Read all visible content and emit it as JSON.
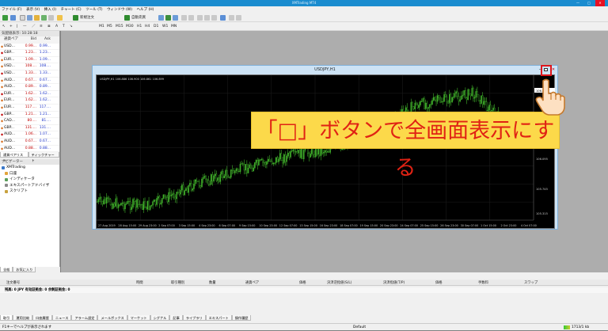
{
  "window": {
    "title": "XMTrading MT4",
    "controls": [
      "—",
      "□",
      "✕"
    ]
  },
  "menu": [
    "ファイル (F)",
    "表示 (V)",
    "挿入 (I)",
    "チャート (C)",
    "ツール (T)",
    "ウィンドウ (W)",
    "ヘルプ (H)"
  ],
  "toolbar1": {
    "new_order": "新規注文",
    "auto_trade": "自動売買"
  },
  "toolbar2": {
    "timeframes": [
      "M1",
      "M5",
      "M15",
      "M30",
      "H1",
      "H4",
      "D1",
      "W1",
      "MN"
    ]
  },
  "market_watch": {
    "title": "気配値表示: 10:28:18",
    "headers": [
      "通貨ペア",
      "Bid",
      "Ask"
    ],
    "rows": [
      {
        "symbol": "USD...",
        "bid": "0.99...",
        "ask": "0.99..."
      },
      {
        "symbol": "GBP...",
        "bid": "1.23...",
        "ask": "1.23..."
      },
      {
        "symbol": "EUR...",
        "bid": "1.09...",
        "ask": "1.09..."
      },
      {
        "symbol": "USD...",
        "bid": "108....",
        "ask": "108...."
      },
      {
        "symbol": "USD...",
        "bid": "1.33...",
        "ask": "1.33..."
      },
      {
        "symbol": "AUD...",
        "bid": "0.67...",
        "ask": "0.67..."
      },
      {
        "symbol": "AUD...",
        "bid": "0.89...",
        "ask": "0.89..."
      },
      {
        "symbol": "EUR...",
        "bid": "1.62...",
        "ask": "1.62..."
      },
      {
        "symbol": "EUR...",
        "bid": "1.62...",
        "ask": "1.62..."
      },
      {
        "symbol": "EUR...",
        "bid": "117....",
        "ask": "117...."
      },
      {
        "symbol": "GBP...",
        "bid": "1.21...",
        "ask": "1.21..."
      },
      {
        "symbol": "CAD...",
        "bid": "80....",
        "ask": "81...."
      },
      {
        "symbol": "GBP...",
        "bid": "131....",
        "ask": "131...."
      },
      {
        "symbol": "AUD...",
        "bid": "1.06...",
        "ask": "1.07..."
      },
      {
        "symbol": "AUD...",
        "bid": "0.67...",
        "ask": "0.67..."
      },
      {
        "symbol": "AUD...",
        "bid": "0.88...",
        "ask": "0.88..."
      }
    ],
    "tabs": [
      "通貨ペアリスト",
      "ティックチャート"
    ]
  },
  "navigator": {
    "title": "ナビゲーター",
    "items": [
      "XMTrading",
      "口座",
      "インディケータ",
      "エキスパートアドバイザ",
      "スクリプト"
    ],
    "tabs": [
      "全般",
      "お気に入り"
    ]
  },
  "chart": {
    "window_title": "USDJPY,H1",
    "symbol_info": "USDJPY,H1  106.886 106.900 106.861 106.899",
    "price_labels": [
      "106.899",
      "106.420",
      "106.095",
      "105.745",
      "105.315"
    ],
    "x_labels": [
      "27 Aug 2019",
      "28 Aug 15:00",
      "29 Aug 23:00",
      "2 Sep 07:00",
      "3 Sep 15:00",
      "4 Sep 23:00",
      "6 Sep 07:00",
      "9 Sep 15:00",
      "10 Sep 23:00",
      "12 Sep 07:00",
      "13 Sep 15:00",
      "16 Sep 23:00",
      "18 Sep 07:00",
      "19 Sep 15:00",
      "20 Sep 23:00",
      "24 Sep 07:00",
      "25 Sep 15:00",
      "26 Sep 23:00",
      "30 Sep 07:00",
      "1 Oct 15:00",
      "2 Oct 23:00",
      "4 Oct 07:00"
    ]
  },
  "annotation": {
    "callout": "「□」ボタンで全画面表示にする"
  },
  "terminal": {
    "columns": [
      "注文番号",
      "時間",
      "取引種別",
      "数量",
      "通貨ペア",
      "価格",
      "決済逆指値(S/L)",
      "決済指値(T/P)",
      "価格",
      "手数料",
      "スワップ"
    ],
    "balance_row": "残高: 0 JPY  有効証拠金: 0  余剰証拠金: 0",
    "tabs": [
      "取引",
      "運用比較",
      "口座履歴",
      "ニュース",
      "アラーム設定",
      "メールボックス",
      "マーケット",
      "シグナル",
      "記事",
      "ライブラリ",
      "エキスパート",
      "操作履歴"
    ]
  },
  "status": {
    "help": "F1キーでヘルプが表示されます",
    "profile": "Default",
    "traffic": "1713/1 kb"
  }
}
